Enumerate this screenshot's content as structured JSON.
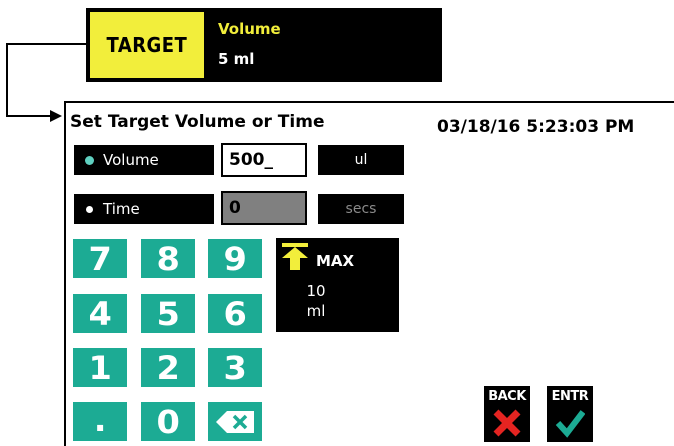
{
  "banner": {
    "target_label": "TARGET",
    "parameter_label": "Volume",
    "parameter_value": "5 ml"
  },
  "dialog": {
    "title": "Set Target Volume or Time",
    "datetime": "03/18/16 5:23:03 PM"
  },
  "modes": {
    "volume": {
      "label": "Volume",
      "value": "500_",
      "unit": "ul",
      "selected": true
    },
    "time": {
      "label": "Time",
      "value": "0",
      "unit": "secs",
      "selected": false
    }
  },
  "keypad": {
    "keys": [
      "7",
      "8",
      "9",
      "4",
      "5",
      "6",
      "1",
      "2",
      "3",
      ".",
      "0"
    ],
    "backspace_icon": "backspace-icon"
  },
  "max_box": {
    "label": "MAX",
    "value": "10",
    "unit": "ml",
    "icon": "up-arrow-icon"
  },
  "nav": {
    "back_label": "BACK",
    "back_icon": "red-x-icon",
    "enter_label": "ENTR",
    "enter_icon": "green-check-icon"
  },
  "colors": {
    "accent_yellow": "#f2ee3b",
    "keypad_green": "#1cab94",
    "back_red": "#e52421",
    "enter_green": "#1cab94"
  }
}
